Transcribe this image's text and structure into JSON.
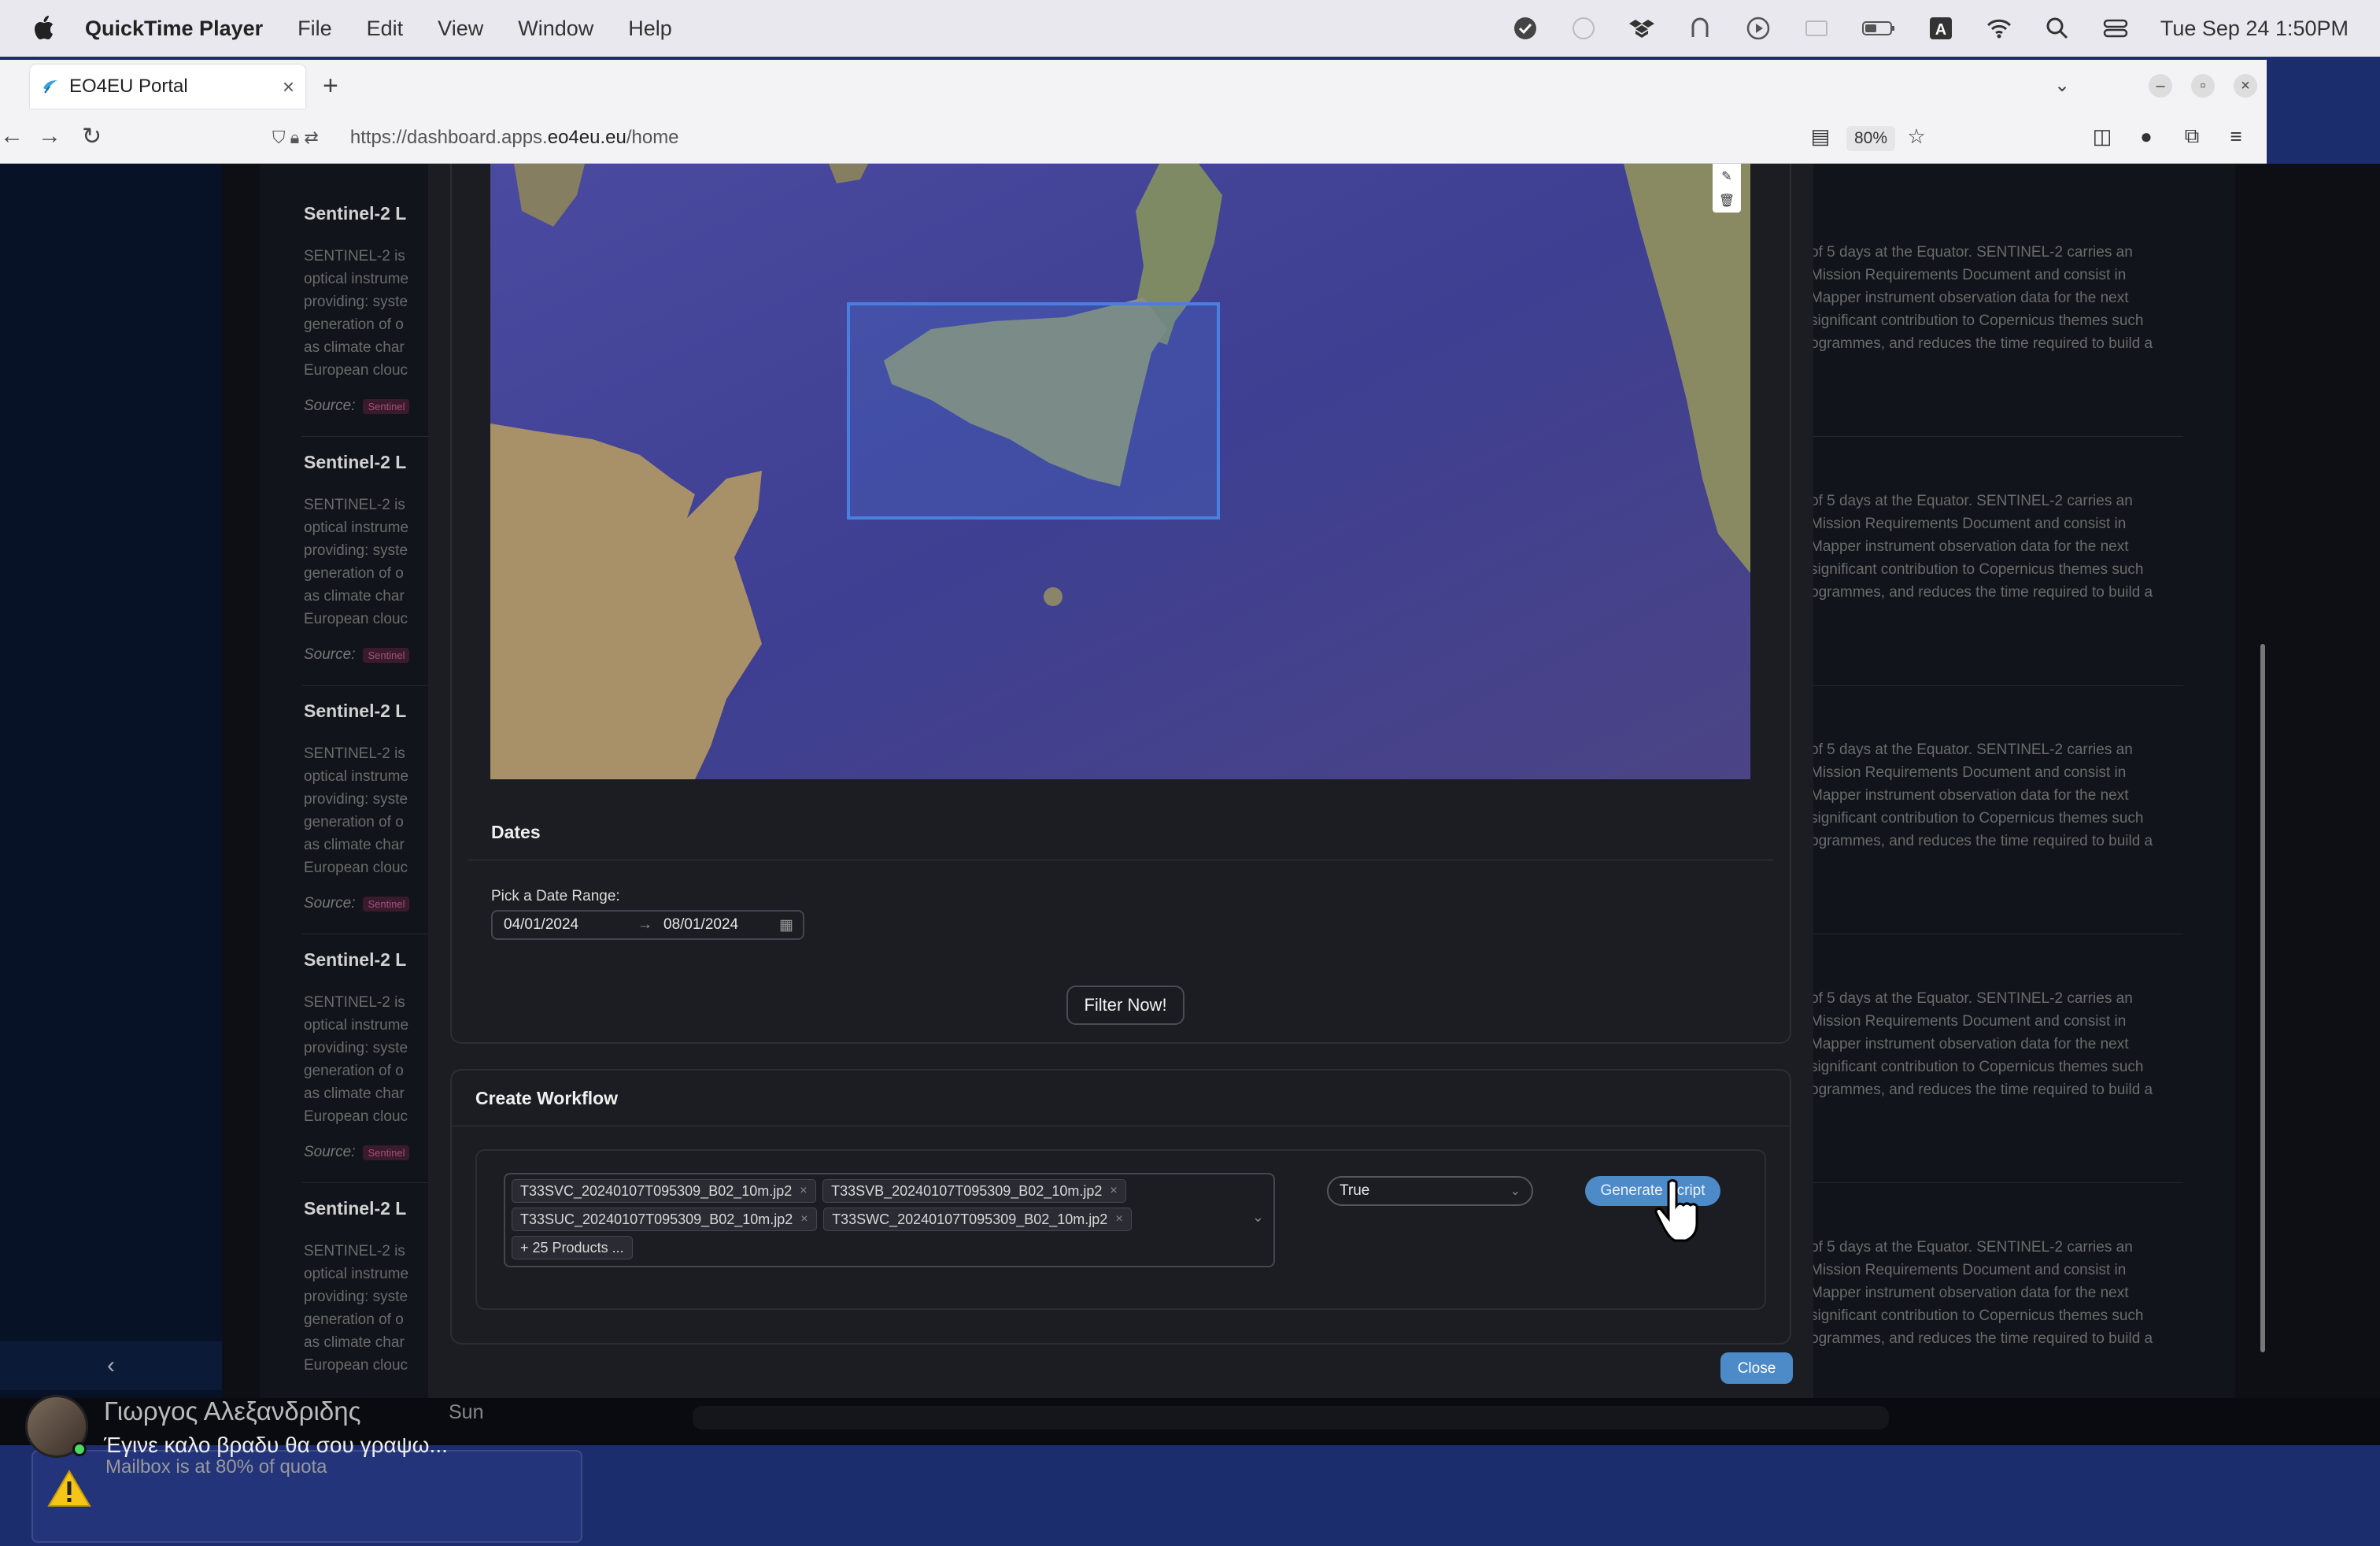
{
  "menubar": {
    "app_name": "QuickTime Player",
    "menus": [
      "File",
      "Edit",
      "View",
      "Window",
      "Help"
    ],
    "clock": "Tue Sep 24  1:50PM"
  },
  "browser": {
    "tab_title": "EO4EU Portal",
    "url_prefix": "https://dashboard.apps.",
    "url_host": "eo4eu.eu",
    "url_path": "/home",
    "zoom": "80%"
  },
  "cards": [
    {
      "title": "Sentinel-2 L",
      "lines": [
        "SENTINEL-2 is",
        "optical instrume",
        "providing: syste",
        "generation of o",
        "as climate char",
        "European clouc"
      ],
      "source_label": "Source:",
      "source_tag": "Sentinel",
      "right": [
        "of 5 days at the Equator. SENTINEL-2 carries an",
        "Mission Requirements Document and consist in",
        "Mapper instrument observation data for the next",
        " significant contribution to Copernicus themes such",
        "ogrammes, and reduces the time required to build a"
      ]
    },
    {
      "title": "Sentinel-2 L",
      "lines": [
        "SENTINEL-2 is",
        "optical instrume",
        "providing: syste",
        "generation of o",
        "as climate char",
        "European clouc"
      ],
      "source_label": "Source:",
      "source_tag": "Sentinel",
      "right": [
        "of 5 days at the Equator. SENTINEL-2 carries an",
        "Mission Requirements Document and consist in",
        "Mapper instrument observation data for the next",
        " significant contribution to Copernicus themes such",
        "ogrammes, and reduces the time required to build a"
      ]
    },
    {
      "title": "Sentinel-2 L",
      "lines": [
        "SENTINEL-2 is",
        "optical instrume",
        "providing: syste",
        "generation of o",
        "as climate char",
        "European clouc"
      ],
      "source_label": "Source:",
      "source_tag": "Sentinel",
      "right": [
        "of 5 days at the Equator. SENTINEL-2 carries an",
        "Mission Requirements Document and consist in",
        "Mapper instrument observation data for the next",
        " significant contribution to Copernicus themes such",
        "ogrammes, and reduces the time required to build a"
      ]
    },
    {
      "title": "Sentinel-2 L",
      "lines": [
        "SENTINEL-2 is",
        "optical instrume",
        "providing: syste",
        "generation of o",
        "as climate char",
        "European clouc"
      ],
      "source_label": "Source:",
      "source_tag": "Sentinel",
      "right": [
        "of 5 days at the Equator. SENTINEL-2 carries an",
        "Mission Requirements Document and consist in",
        "Mapper instrument observation data for the next",
        " significant contribution to Copernicus themes such",
        "ogrammes, and reduces the time required to build a"
      ]
    },
    {
      "title": "Sentinel-2 L",
      "lines": [
        "SENTINEL-2 is",
        "optical instrume",
        "providing: syste",
        "generation of o",
        "as climate char",
        "European clouc"
      ],
      "source_label": "",
      "source_tag": "",
      "right": [
        "of 5 days at the Equator. SENTINEL-2 carries an",
        "Mission Requirements Document and consist in",
        "Mapper instrument observation data for the next",
        " significant contribution to Copernicus themes such",
        "ogrammes, and reduces the time required to build a"
      ]
    }
  ],
  "dates": {
    "title": "Dates",
    "range_label": "Pick a Date Range:",
    "start": "04/01/2024",
    "end": "08/01/2024",
    "filter_button": "Filter Now!"
  },
  "workflow": {
    "title": "Create Workflow",
    "products": [
      "T33SVC_20240107T095309_B02_10m.jp2",
      "T33SVB_20240107T095309_B02_10m.jp2",
      "T33SUC_20240107T095309_B02_10m.jp2",
      "T33SWC_20240107T095309_B02_10m.jp2"
    ],
    "more_products": "+ 25 Products ...",
    "option_value": "True",
    "generate_button": "Generate Script",
    "close_button": "Close"
  },
  "notification": {
    "sender": "Γιωργος Αλεξανδριδης",
    "time": "Sun",
    "message": "Έγινε καλο βραδυ θα σου γραψω...",
    "mailbox": "Mailbox is at 80% of quota"
  },
  "colors": {
    "accent_button": "#4d8ac8",
    "modal_bg": "#1c1d22",
    "selection_box": "#4a7fe0"
  }
}
